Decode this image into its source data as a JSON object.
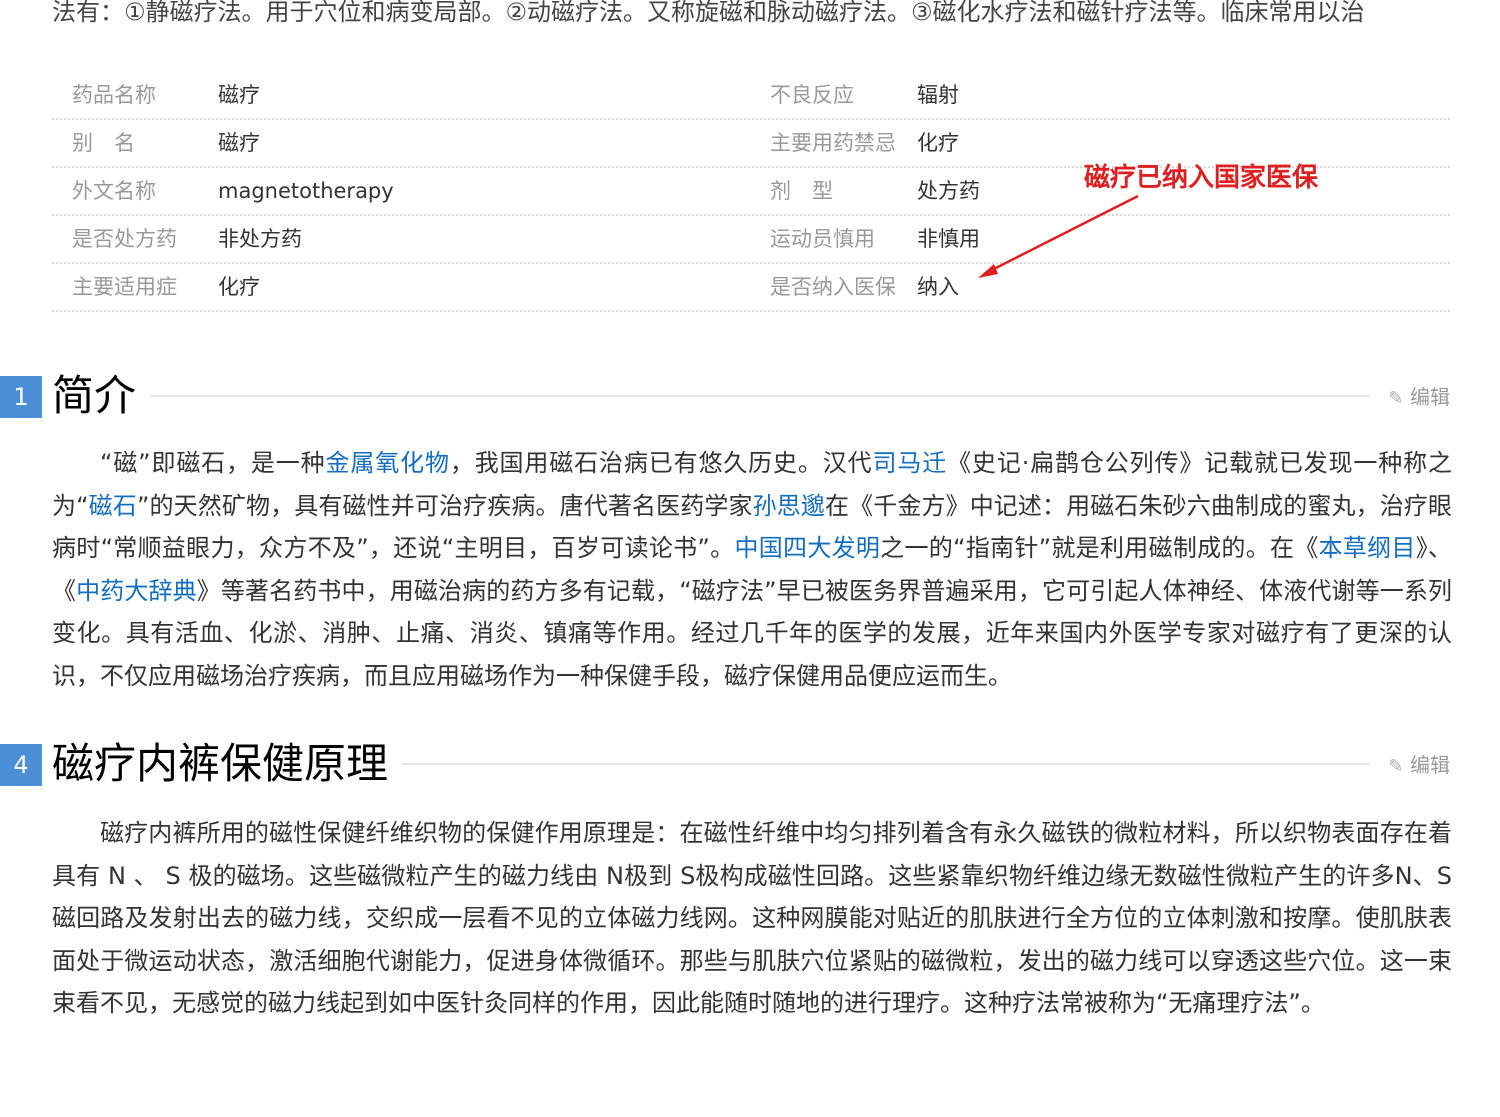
{
  "top_text": "法有：①静磁疗法。用于穴位和病变局部。②动磁疗法。又称旋磁和脉动磁疗法。③磁化水疗法和磁针疗法等。临床常用以治",
  "info": {
    "rows": [
      {
        "l_label": "药品名称",
        "l_value": "磁疗",
        "r_label": "不良反应",
        "r_value": "辐射"
      },
      {
        "l_label": "别　名",
        "l_value": "磁疗",
        "r_label": "主要用药禁忌",
        "r_value": "化疗"
      },
      {
        "l_label": "外文名称",
        "l_value": "magnetotherapy",
        "r_label": "剂　型",
        "r_value": "处方药"
      },
      {
        "l_label": "是否处方药",
        "l_value": "非处方药",
        "r_label": "运动员慎用",
        "r_value": "非慎用"
      },
      {
        "l_label": "主要适用症",
        "l_value": "化疗",
        "r_label": "是否纳入医保",
        "r_value": "纳入"
      }
    ]
  },
  "annotation": {
    "text": "磁疗已纳入国家医保",
    "color": "#e02020"
  },
  "sections": [
    {
      "number": "1",
      "title": "简介",
      "edit_label": "编辑",
      "paragraph": [
        {
          "t": "“磁”即磁石，是一种"
        },
        {
          "t": "金属氧化物",
          "link": true
        },
        {
          "t": "，我国用磁石治病已有悠久历史。汉代"
        },
        {
          "t": "司马迁",
          "link": true
        },
        {
          "t": "《史记·扁鹊仓公列传》记载就已发现一种称之为“"
        },
        {
          "t": "磁石",
          "link": true
        },
        {
          "t": "”的天然矿物，具有磁性并可治疗疾病。唐代著名医药学家"
        },
        {
          "t": "孙思邈",
          "link": true
        },
        {
          "t": "在《千金方》中记述：用磁石朱砂六曲制成的蜜丸，治疗眼病时“常顺益眼力，众方不及”，还说“主明目，百岁可读论书”。"
        },
        {
          "t": "中国四大发明",
          "link": true
        },
        {
          "t": "之一的“指南针”就是利用磁制成的。在《"
        },
        {
          "t": "本草纲目",
          "link": true
        },
        {
          "t": "》、《"
        },
        {
          "t": "中药大辞典",
          "link": true
        },
        {
          "t": "》等著名药书中，用磁治病的药方多有记载，“磁疗法”早已被医务界普遍采用，它可引起人体神经、体液代谢等一系列变化。具有活血、化淤、消肿、止痛、消炎、镇痛等作用。经过几千年的医学的发展，近年来国内外医学专家对磁疗有了更深的认识，不仅应用磁场治疗疾病，而且应用磁场作为一种保健手段，磁疗保健用品便应运而生。"
        }
      ]
    },
    {
      "number": "4",
      "title": "磁疗内裤保健原理",
      "edit_label": "编辑",
      "paragraph": [
        {
          "t": "磁疗内裤所用的磁性保健纤维织物的保健作用原理是：在磁性纤维中均匀排列着含有永久磁铁的微粒材料，所以织物表面存在着具有 N 、 S 极的磁场。这些磁微粒产生的磁力线由 N极到 S极构成磁性回路。这些紧靠织物纤维边缘无数磁性微粒产生的许多N、S磁回路及发射出去的磁力线，交织成一层看不见的立体磁力线网。这种网膜能对贴近的肌肤进行全方位的立体刺激和按摩。使肌肤表面处于微运动状态，激活细胞代谢能力，促进身体微循环。那些与肌肤穴位紧贴的磁微粒，发出的磁力线可以穿透这些穴位。这一束束看不见，无感觉的磁力线起到如中医针灸同样的作用，因此能随时随地的进行理疗。这种疗法常被称为“无痛理疗法”。"
        }
      ]
    }
  ],
  "colors": {
    "link": "#136ec2",
    "section_number_bg": "#4d8fd6",
    "label": "#999999"
  }
}
